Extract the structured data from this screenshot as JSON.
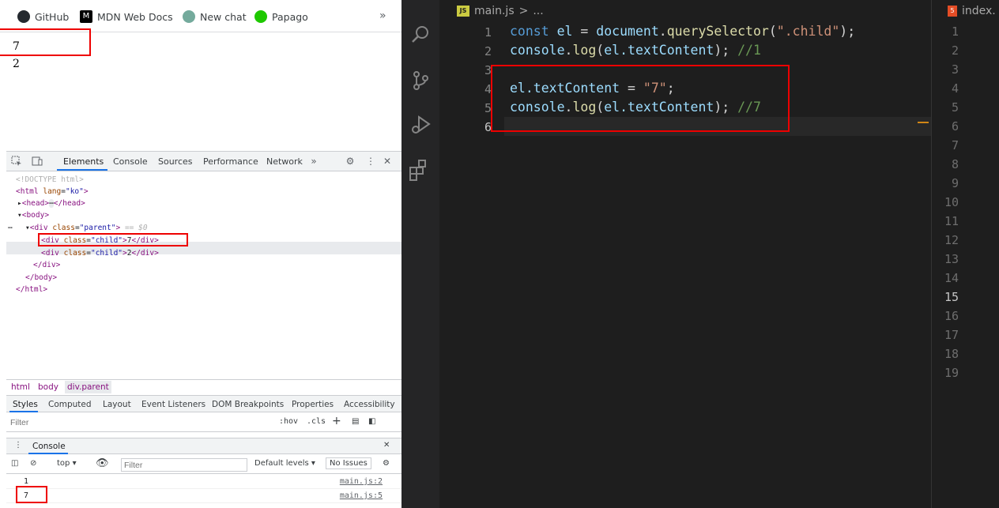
{
  "browser": {
    "bookmarks": [
      {
        "label": "GitHub",
        "icon": "github-icon"
      },
      {
        "label": "MDN Web Docs",
        "icon": "mdn-icon"
      },
      {
        "label": "New chat",
        "icon": "chatgpt-icon"
      },
      {
        "label": "Papago",
        "icon": "papago-icon"
      }
    ],
    "more_label": "»",
    "page_lines": [
      "7",
      "2"
    ]
  },
  "devtools": {
    "tabs": [
      "Elements",
      "Console",
      "Sources",
      "Performance",
      "Network"
    ],
    "active_tab": "Elements",
    "dom": {
      "doctype": "<!DOCTYPE html>",
      "html_open_tag": "<html",
      "html_attr": "lang",
      "html_val": "\"ko\"",
      "html_close_bracket": ">",
      "head": "<head>",
      "head_end": "</head>",
      "body_open": "<body>",
      "parent_open": "<div",
      "parent_attr": "class",
      "parent_val": "\"parent\"",
      "parent_bracket": ">",
      "parent_marker": "== $0",
      "child1_open": "<div",
      "child1_attr": "class",
      "child1_val": "\"child\"",
      "child1_text": "7",
      "child1_close": "</div>",
      "child2_open": "<div",
      "child2_attr": "class",
      "child2_val": "\"child\"",
      "child2_text": "2",
      "child2_close": "</div>",
      "parent_close": "</div>",
      "body_close": "</body>",
      "html_close": "</html>"
    },
    "breadcrumbs": [
      "html",
      "body",
      "div.parent"
    ],
    "sub_tabs": [
      "Styles",
      "Computed",
      "Layout",
      "Event Listeners",
      "DOM Breakpoints",
      "Properties",
      "Accessibility"
    ],
    "styles_filter_placeholder": "Filter",
    "hov_label": ":hov",
    "cls_label": ".cls",
    "drawer_tab": "Console",
    "console_context": "top",
    "console_filter_placeholder": "Filter",
    "levels_label": "Default levels",
    "issues_label": "No Issues",
    "console_rows": [
      {
        "value": "1",
        "source": "main.js:2"
      },
      {
        "value": "7",
        "source": "main.js:5"
      }
    ]
  },
  "vscode": {
    "file_name": "main.js",
    "crumb_sep": ">",
    "crumb_more": "...",
    "split_tab": "index.",
    "split_line_numbers": [
      "1",
      "2",
      "3",
      "4",
      "5",
      "6",
      "7",
      "8",
      "9",
      "10",
      "11",
      "12",
      "13",
      "14",
      "15",
      "16",
      "17",
      "18",
      "19"
    ],
    "line_numbers": [
      "1",
      "2",
      "3",
      "4",
      "5",
      "6"
    ],
    "code": {
      "l1": {
        "kw": "const",
        "var": "el",
        "eq": " = ",
        "obj": "document",
        "dot": ".",
        "fn": "querySelector",
        "open": "(",
        "str": "\".child\"",
        "close": ");"
      },
      "l2": {
        "obj": "console",
        "dot": ".",
        "fn": "log",
        "open": "(",
        "arg": "el.textContent",
        "close": ");",
        "com": "//1"
      },
      "l4": {
        "var": "el.textContent",
        "eq": " = ",
        "str": "\"7\"",
        "end": ";"
      },
      "l5": {
        "obj": "console",
        "dot": ".",
        "fn": "log",
        "open": "(",
        "arg": "el.textContent",
        "close": ");",
        "com": "//7"
      }
    }
  },
  "colors": {
    "highlight_box": "#e00000",
    "vscode_bg": "#1e1e1e",
    "devtools_accent": "#1a73e8"
  }
}
